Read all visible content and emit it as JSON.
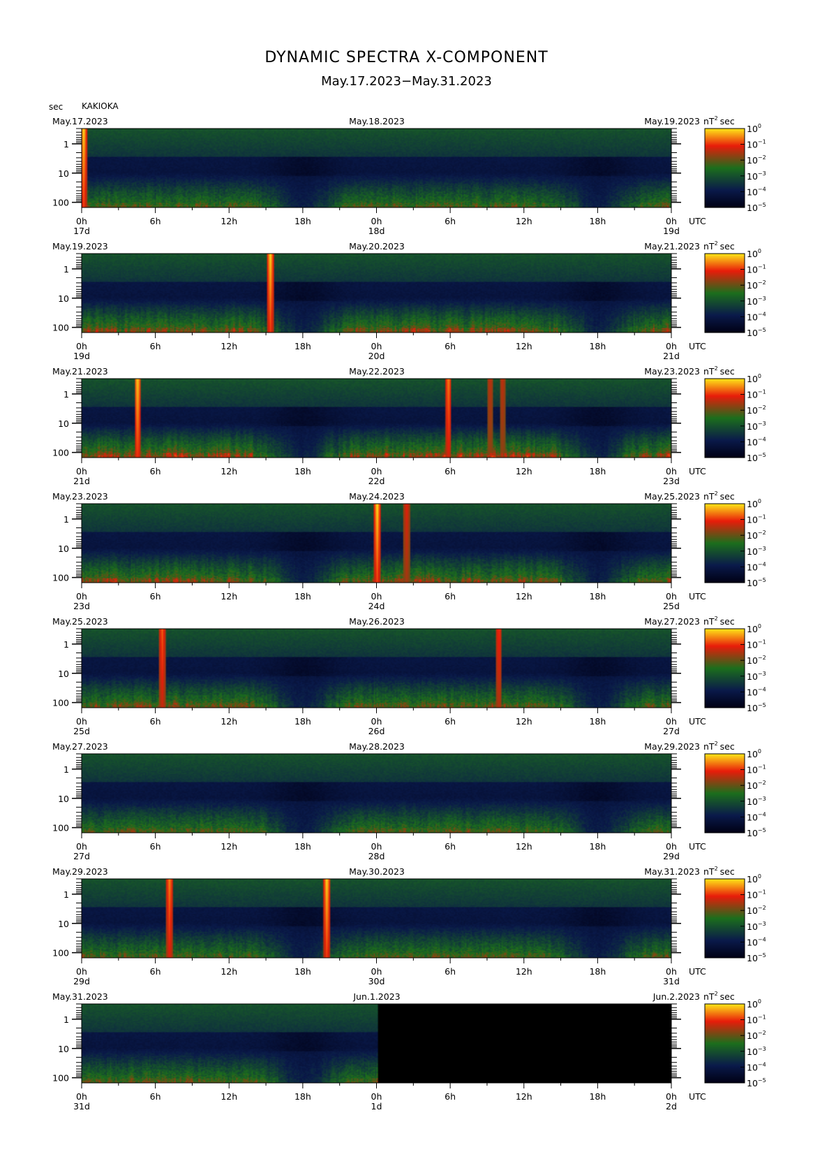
{
  "title": "DYNAMIC SPECTRA X-COMPONENT",
  "subtitle": "May.17.2023−May.31.2023",
  "station": "KAKIOKA",
  "y_unit": "sec",
  "x_unit": "UTC",
  "colorbar_unit": "nT",
  "colorbar_unit_exp": "2",
  "colorbar_unit_suffix": "sec",
  "colors": {
    "cmap": [
      "#000014",
      "#0a1a4a",
      "#1c6e1c",
      "#e81c0a",
      "#ffe818"
    ],
    "missing": "#000000"
  },
  "chart_data": [
    {
      "type": "heatmap",
      "date_start": "May.17.2023",
      "date_mid": "May.18.2023",
      "date_end": "May.19.2023",
      "x_tick_labels": [
        "0h",
        "6h",
        "12h",
        "18h",
        "0h",
        "6h",
        "12h",
        "18h",
        "0h"
      ],
      "day_labels": [
        "17d",
        "18d",
        "19d"
      ],
      "y_ticks": [
        "1",
        "10",
        "100"
      ],
      "colorbar_ticks": [
        "10",
        "10",
        "10",
        "10",
        "10",
        "10"
      ],
      "colorbar_exps": [
        "0",
        "−1",
        "−2",
        "−3",
        "−4",
        "−5"
      ],
      "events": [
        {
          "t": 0.1,
          "intensity": 1.0
        }
      ],
      "data_until_h": 48,
      "activity": 0.45
    },
    {
      "type": "heatmap",
      "date_start": "May.19.2023",
      "date_mid": "May.20.2023",
      "date_end": "May.21.2023",
      "x_tick_labels": [
        "0h",
        "6h",
        "12h",
        "18h",
        "0h",
        "6h",
        "12h",
        "18h",
        "0h"
      ],
      "day_labels": [
        "19d",
        "20d",
        "21d"
      ],
      "y_ticks": [
        "1",
        "10",
        "100"
      ],
      "colorbar_ticks": [
        "10",
        "10",
        "10",
        "10",
        "10",
        "10"
      ],
      "colorbar_exps": [
        "0",
        "−1",
        "−2",
        "−3",
        "−4",
        "−5"
      ],
      "events": [
        {
          "t": 15.3,
          "intensity": 1.0
        }
      ],
      "data_until_h": 48,
      "activity": 0.75
    },
    {
      "type": "heatmap",
      "date_start": "May.21.2023",
      "date_mid": "May.22.2023",
      "date_end": "May.23.2023",
      "x_tick_labels": [
        "0h",
        "6h",
        "12h",
        "18h",
        "0h",
        "6h",
        "12h",
        "18h",
        "0h"
      ],
      "day_labels": [
        "21d",
        "22d",
        "23d"
      ],
      "y_ticks": [
        "1",
        "10",
        "100"
      ],
      "colorbar_ticks": [
        "10",
        "10",
        "10",
        "10",
        "10",
        "10"
      ],
      "colorbar_exps": [
        "0",
        "−1",
        "−2",
        "−3",
        "−4",
        "−5"
      ],
      "events": [
        {
          "t": 4.5,
          "intensity": 1.0
        },
        {
          "t": 29.8,
          "intensity": 0.8
        },
        {
          "t": 33.2,
          "intensity": 0.4
        },
        {
          "t": 34.2,
          "intensity": 0.4
        }
      ],
      "data_until_h": 48,
      "activity": 0.85
    },
    {
      "type": "heatmap",
      "date_start": "May.23.2023",
      "date_mid": "May.24.2023",
      "date_end": "May.25.2023",
      "x_tick_labels": [
        "0h",
        "6h",
        "12h",
        "18h",
        "0h",
        "6h",
        "12h",
        "18h",
        "0h"
      ],
      "day_labels": [
        "23d",
        "24d",
        "25d"
      ],
      "y_ticks": [
        "1",
        "10",
        "100"
      ],
      "colorbar_ticks": [
        "10",
        "10",
        "10",
        "10",
        "10",
        "10"
      ],
      "colorbar_exps": [
        "0",
        "−1",
        "−2",
        "−3",
        "−4",
        "−5"
      ],
      "events": [
        {
          "t": 24.0,
          "intensity": 1.0
        },
        {
          "t": 26.4,
          "intensity": 0.5
        }
      ],
      "data_until_h": 48,
      "activity": 0.7
    },
    {
      "type": "heatmap",
      "date_start": "May.25.2023",
      "date_mid": "May.26.2023",
      "date_end": "May.27.2023",
      "x_tick_labels": [
        "0h",
        "6h",
        "12h",
        "18h",
        "0h",
        "6h",
        "12h",
        "18h",
        "0h"
      ],
      "day_labels": [
        "25d",
        "26d",
        "27d"
      ],
      "y_ticks": [
        "1",
        "10",
        "100"
      ],
      "colorbar_ticks": [
        "10",
        "10",
        "10",
        "10",
        "10",
        "10"
      ],
      "colorbar_exps": [
        "0",
        "−1",
        "−2",
        "−3",
        "−4",
        "−5"
      ],
      "events": [
        {
          "t": 6.5,
          "intensity": 0.7
        },
        {
          "t": 33.9,
          "intensity": 0.6
        }
      ],
      "data_until_h": 48,
      "activity": 0.6
    },
    {
      "type": "heatmap",
      "date_start": "May.27.2023",
      "date_mid": "May.28.2023",
      "date_end": "May.29.2023",
      "x_tick_labels": [
        "0h",
        "6h",
        "12h",
        "18h",
        "0h",
        "6h",
        "12h",
        "18h",
        "0h"
      ],
      "day_labels": [
        "27d",
        "28d",
        "29d"
      ],
      "y_ticks": [
        "1",
        "10",
        "100"
      ],
      "colorbar_ticks": [
        "10",
        "10",
        "10",
        "10",
        "10",
        "10"
      ],
      "colorbar_exps": [
        "0",
        "−1",
        "−2",
        "−3",
        "−4",
        "−5"
      ],
      "events": [],
      "data_until_h": 48,
      "activity": 0.45
    },
    {
      "type": "heatmap",
      "date_start": "May.29.2023",
      "date_mid": "May.30.2023",
      "date_end": "May.31.2023",
      "x_tick_labels": [
        "0h",
        "6h",
        "12h",
        "18h",
        "0h",
        "6h",
        "12h",
        "18h",
        "0h"
      ],
      "day_labels": [
        "29d",
        "30d",
        "31d"
      ],
      "y_ticks": [
        "1",
        "10",
        "100"
      ],
      "colorbar_ticks": [
        "10",
        "10",
        "10",
        "10",
        "10",
        "10"
      ],
      "colorbar_exps": [
        "0",
        "−1",
        "−2",
        "−3",
        "−4",
        "−5"
      ],
      "events": [
        {
          "t": 7.1,
          "intensity": 0.8
        },
        {
          "t": 19.9,
          "intensity": 1.0
        }
      ],
      "data_until_h": 48,
      "activity": 0.45
    },
    {
      "type": "heatmap",
      "date_start": "May.31.2023",
      "date_mid": "Jun.1.2023",
      "date_end": "Jun.2.2023",
      "x_tick_labels": [
        "0h",
        "6h",
        "12h",
        "18h",
        "0h",
        "6h",
        "12h",
        "18h",
        "0h"
      ],
      "day_labels": [
        "31d",
        "1d",
        "2d"
      ],
      "y_ticks": [
        "1",
        "10",
        "100"
      ],
      "colorbar_ticks": [
        "10",
        "10",
        "10",
        "10",
        "10",
        "10"
      ],
      "colorbar_exps": [
        "0",
        "−1",
        "−2",
        "−3",
        "−4",
        "−5"
      ],
      "events": [],
      "data_until_h": 24,
      "activity": 0.5
    }
  ]
}
